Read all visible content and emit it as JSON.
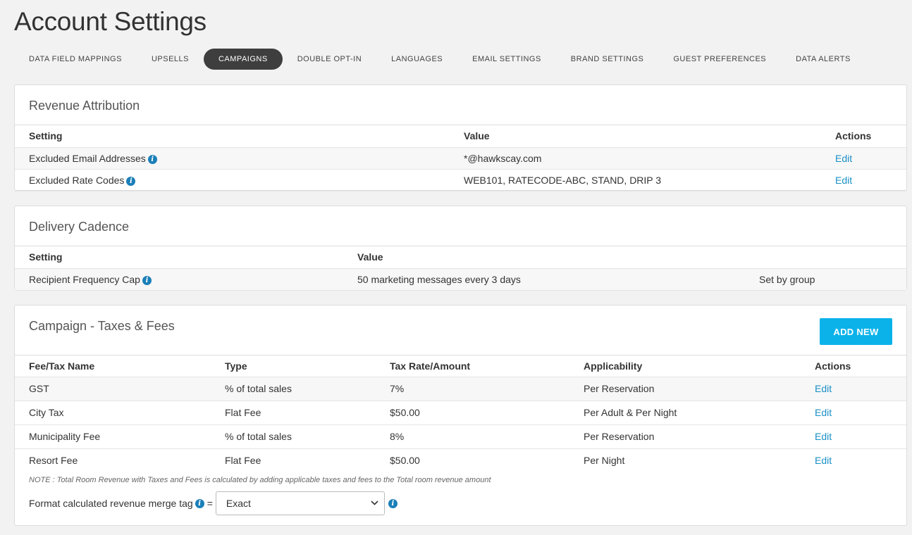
{
  "page_title": "Account Settings",
  "tabs": [
    {
      "label": "DATA FIELD MAPPINGS",
      "active": false
    },
    {
      "label": "UPSELLS",
      "active": false
    },
    {
      "label": "CAMPAIGNS",
      "active": true
    },
    {
      "label": "DOUBLE OPT-IN",
      "active": false
    },
    {
      "label": "LANGUAGES",
      "active": false
    },
    {
      "label": "EMAIL SETTINGS",
      "active": false
    },
    {
      "label": "BRAND SETTINGS",
      "active": false
    },
    {
      "label": "GUEST PREFERENCES",
      "active": false
    },
    {
      "label": "DATA ALERTS",
      "active": false
    }
  ],
  "revenue": {
    "title": "Revenue Attribution",
    "headers": {
      "setting": "Setting",
      "value": "Value",
      "actions": "Actions"
    },
    "rows": [
      {
        "setting": "Excluded Email Addresses",
        "value": "*@hawkscay.com",
        "action": "Edit"
      },
      {
        "setting": "Excluded Rate Codes",
        "value": "WEB101, RATECODE-ABC, STAND, DRIP 3",
        "action": "Edit"
      }
    ]
  },
  "delivery": {
    "title": "Delivery Cadence",
    "headers": {
      "setting": "Setting",
      "value": "Value"
    },
    "rows": [
      {
        "setting": "Recipient Frequency Cap",
        "value": "50 marketing messages every 3 days",
        "extra": "Set by group"
      }
    ]
  },
  "fees": {
    "title": "Campaign - Taxes & Fees",
    "add_label": "ADD NEW",
    "headers": {
      "name": "Fee/Tax Name",
      "type": "Type",
      "rate": "Tax Rate/Amount",
      "applicability": "Applicability",
      "actions": "Actions"
    },
    "rows": [
      {
        "name": "GST",
        "type": "% of total sales",
        "rate": "7%",
        "applicability": "Per Reservation",
        "action": "Edit"
      },
      {
        "name": "City Tax",
        "type": "Flat Fee",
        "rate": "$50.00",
        "applicability": "Per Adult & Per Night",
        "action": "Edit"
      },
      {
        "name": "Municipality Fee",
        "type": "% of total sales",
        "rate": "8%",
        "applicability": "Per Reservation",
        "action": "Edit"
      },
      {
        "name": "Resort Fee",
        "type": "Flat Fee",
        "rate": "$50.00",
        "applicability": "Per Night",
        "action": "Edit"
      }
    ],
    "note": "NOTE : Total Room Revenue with Taxes and Fees is calculated by adding applicable taxes and fees to the Total room revenue amount",
    "format_label": "Format calculated revenue merge tag",
    "format_equals": "=",
    "format_value": "Exact"
  },
  "icons": {
    "info": "info-icon",
    "chevron": "chevron-down-icon"
  },
  "colors": {
    "accent": "#0bb2ea",
    "link": "#1a8fc6",
    "active_tab": "#3e3e3e",
    "info": "#1a7fb8"
  }
}
